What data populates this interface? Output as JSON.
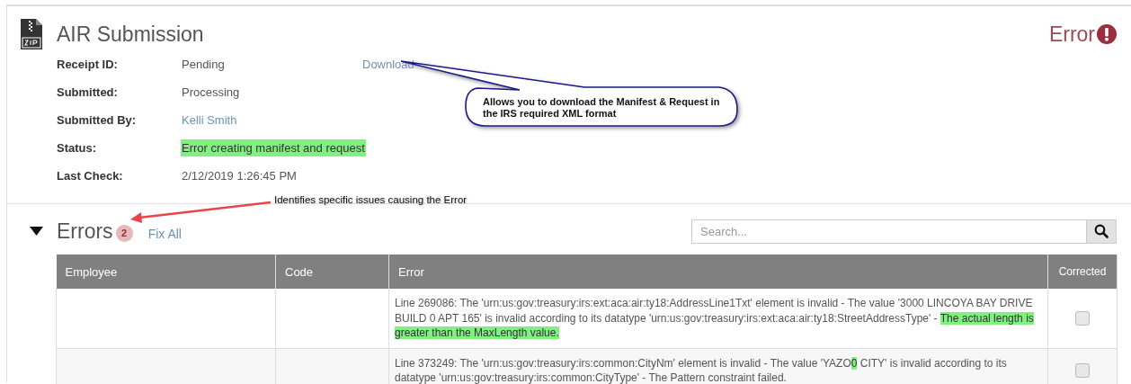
{
  "submission": {
    "title": "AIR Submission",
    "status": {
      "label": "Error",
      "kind": "error"
    },
    "fields": [
      {
        "label": "Receipt ID:",
        "value": "Pending",
        "kind": "text",
        "action": "Download"
      },
      {
        "label": "Submitted:",
        "value": "Processing",
        "kind": "text"
      },
      {
        "label": "Submitted By:",
        "value": "Kelli Smith",
        "kind": "link"
      },
      {
        "label": "Status:",
        "value": "Error creating manifest and request ",
        "kind": "highlight"
      },
      {
        "label": "Last Check:",
        "value": "2/12/2019 1:26:45 PM",
        "kind": "text"
      }
    ]
  },
  "errors": {
    "title": "Errors",
    "expanded": true,
    "count": "2",
    "fix_all": "Fix All",
    "search": {
      "placeholder": "Search..."
    },
    "table": {
      "columns": [
        "Employee",
        "Code",
        "Error",
        "Corrected"
      ],
      "rows": [
        {
          "employee": "",
          "code": "",
          "error": [
            {
              "text": "Line 269086: The 'urn:us:gov:treasury:irs:ext:aca:air:ty18:AddressLine1Txt' element is invalid - The value '3000 LINCOYA BAY DRIVE BUILD 0 APT 165' is invalid according to its datatype 'urn:us:gov:treasury:irs:ext:aca:air:ty18:StreetAddressType' - ",
              "highlighted": false
            },
            {
              "text": "The actual length is greater than the MaxLength value.",
              "highlighted": true
            }
          ],
          "corrected": false
        },
        {
          "employee": "",
          "code": "",
          "error": [
            {
              "text": "Line 373249: The 'urn:us:gov:treasury:irs:common:CityNm' element is invalid - The value 'YAZO",
              "highlighted": false
            },
            {
              "text": "0",
              "highlighted": true
            },
            {
              "text": " CITY' is invalid according to its datatype 'urn:us:gov:treasury:irs:common:CityType' - The Pattern constraint failed.",
              "highlighted": false
            }
          ],
          "corrected": false
        }
      ]
    }
  },
  "annotations": [
    {
      "kind": "callout",
      "text": "Allows you to download the Manifest & Request in the IRS required XML format"
    },
    {
      "kind": "arrow",
      "text": "Identifies specific issues causing the Error"
    }
  ]
}
